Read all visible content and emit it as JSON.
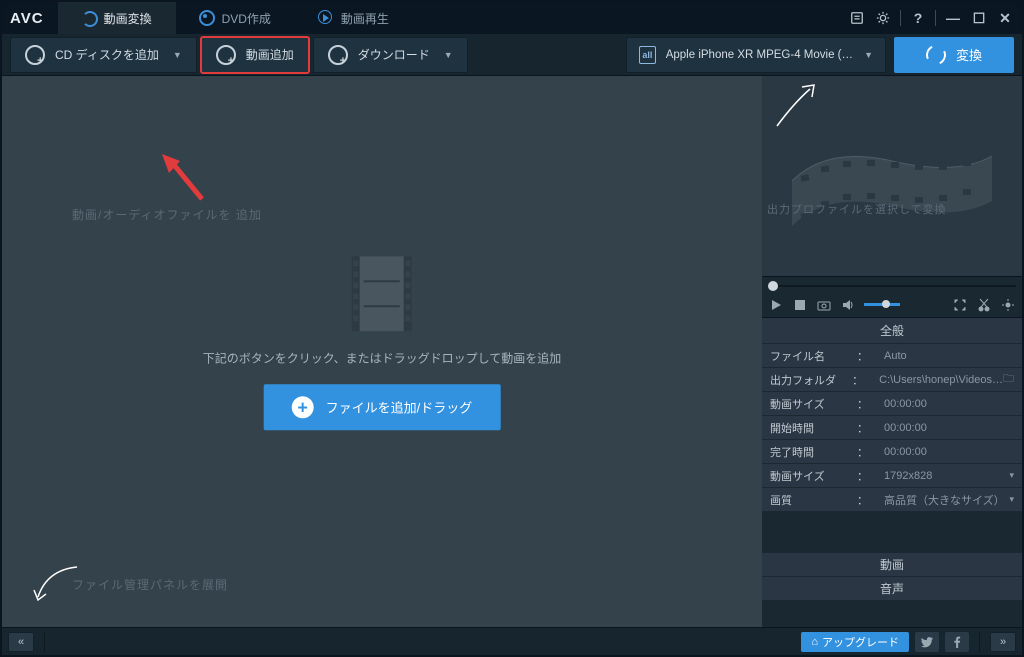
{
  "app": {
    "logo": "AVC"
  },
  "tabs": {
    "convert": "動画変換",
    "dvd": "DVD作成",
    "play": "動画再生"
  },
  "toolbar": {
    "add_disc": "CD ディスクを追加",
    "add_video": "動画追加",
    "download": "ダウンロード",
    "profile": "Apple iPhone XR MPEG-4 Movie (*.m…",
    "profile_badge": "all",
    "convert": "変換"
  },
  "hints": {
    "add_file": "動画/オーディオファイルを 追加",
    "expand": "ファイル管理パネルを展開",
    "profile": "出力プロファイルを選択して変換"
  },
  "dropzone": {
    "text": "下記のボタンをクリック、またはドラッグドロップして動画を追加",
    "button": "ファイルを追加/ドラッグ"
  },
  "props": {
    "header": "全般",
    "filename_label": "ファイル名",
    "filename_value": "Auto",
    "outfolder_label": "出力フォルダ",
    "outfolder_value": "C:\\Users\\honep\\Videos…",
    "videosize_label": "動画サイズ",
    "videosize_value": "00:00:00",
    "starttime_label": "開始時間",
    "starttime_value": "00:00:00",
    "endtime_label": "完了時間",
    "endtime_value": "00:00:00",
    "dimension_label": "動画サイズ",
    "dimension_value": "1792x828",
    "quality_label": "画質",
    "quality_value": "高品質（大きなサイズ）"
  },
  "sections": {
    "video": "動画",
    "audio": "音声"
  },
  "status": {
    "upgrade": "アップグレード"
  }
}
